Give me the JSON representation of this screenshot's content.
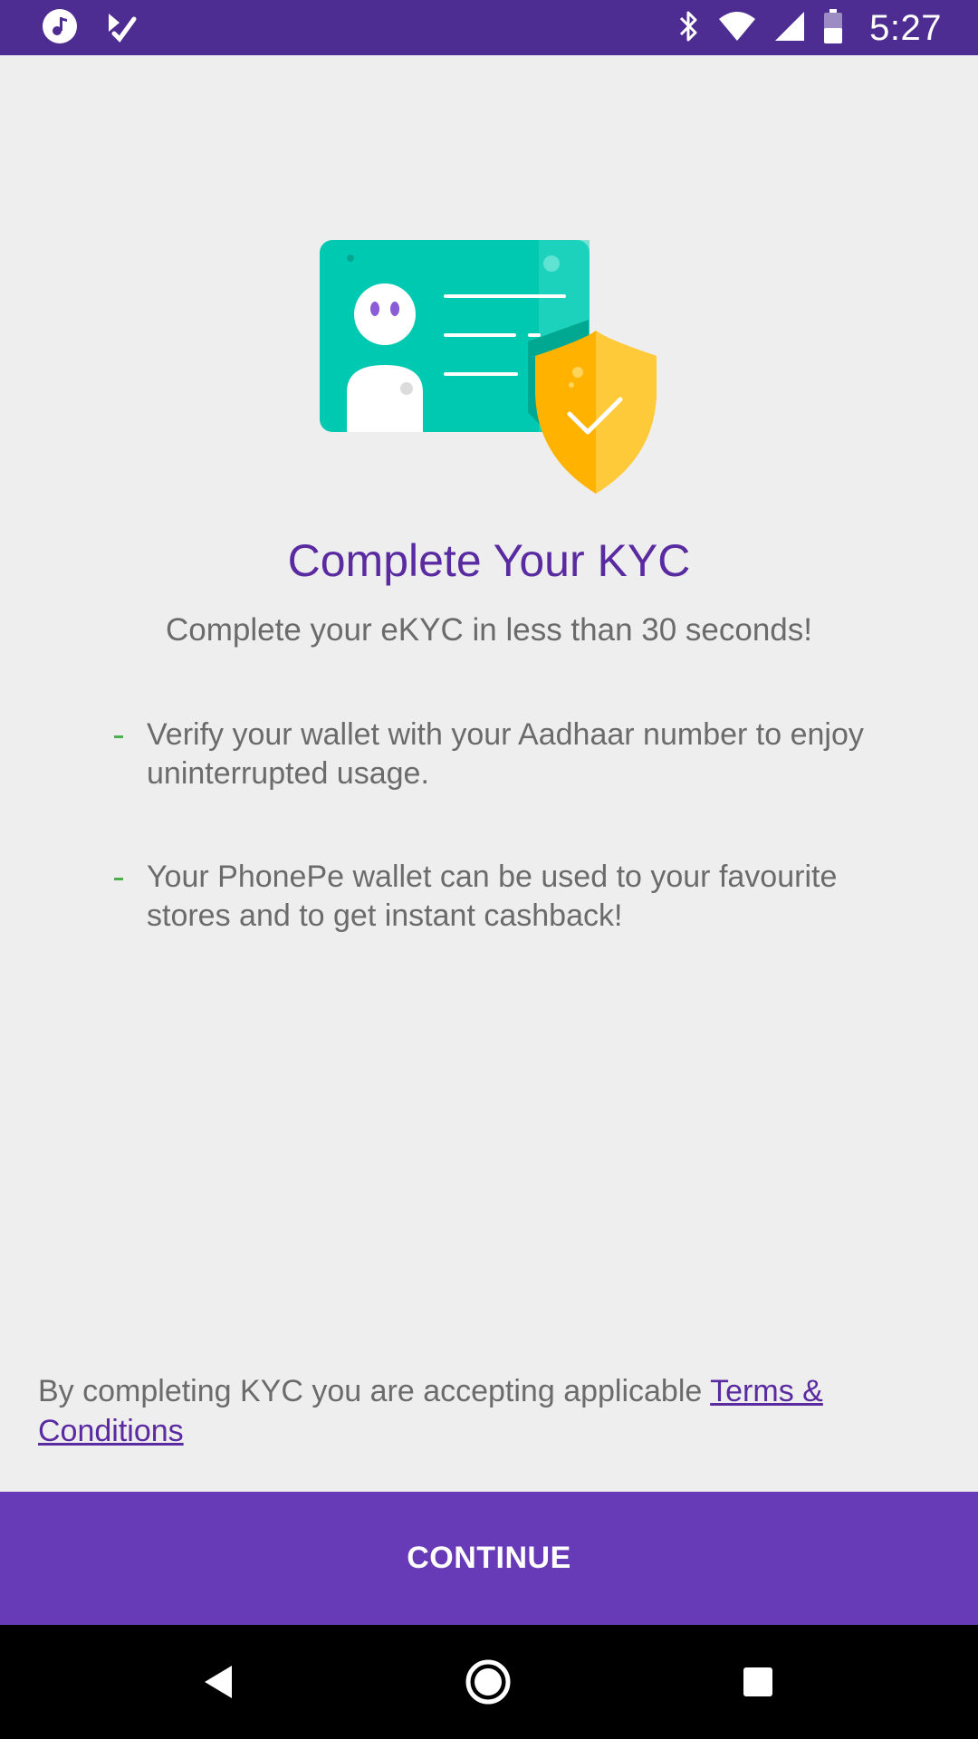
{
  "status_bar": {
    "time": "5:27",
    "icons_left": [
      "music-icon",
      "tasks-check-icon"
    ],
    "icons_right": [
      "bluetooth-icon",
      "wifi-icon",
      "signal-icon",
      "battery-icon"
    ]
  },
  "kyc": {
    "title": "Complete Your KYC",
    "subtitle": "Complete your eKYC in less than 30 seconds!",
    "points": [
      "Verify your wallet with your Aadhaar number to enjoy uninterrupted usage.",
      "Your PhonePe wallet can be used to your favourite stores and to get instant cashback!"
    ],
    "terms_text": "By completing KYC you are accepting applicable ",
    "terms_link": "Terms & Conditions",
    "continue_label": "CONTINUE"
  },
  "navigation": {
    "buttons": [
      "back-icon",
      "home-icon",
      "recents-icon"
    ]
  },
  "colors": {
    "status_bar": "#4e2d92",
    "primary": "#673ab7",
    "title": "#5a2aa0",
    "background": "#eeeeee",
    "bullet": "#4caf50",
    "card": "#00c9b1",
    "shield": "#ffb300"
  }
}
